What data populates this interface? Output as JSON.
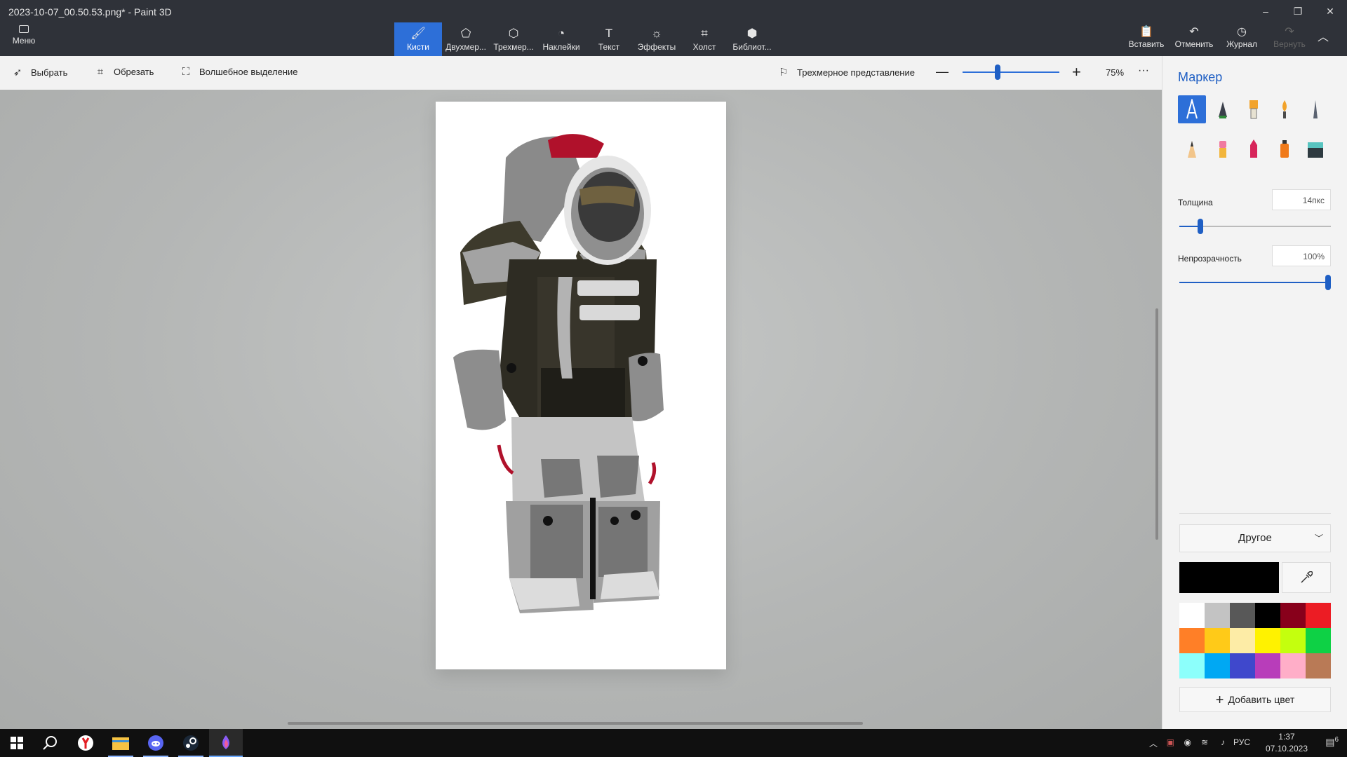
{
  "window": {
    "title": "2023-10-07_00.50.53.png* - Paint 3D",
    "controls": {
      "minimize": "–",
      "restore": "❐",
      "close": "✕"
    }
  },
  "ribbon": {
    "menu_label": "Меню",
    "tabs": [
      {
        "label": "Кисти",
        "icon": "brush-icon",
        "glyph": "🖌"
      },
      {
        "label": "Двухмер...",
        "icon": "shapes-2d-icon",
        "glyph": "⬠"
      },
      {
        "label": "Трехмер...",
        "icon": "cube-icon",
        "glyph": "⬡"
      },
      {
        "label": "Наклейки",
        "icon": "sticker-icon",
        "glyph": "◔"
      },
      {
        "label": "Текст",
        "icon": "text-icon",
        "glyph": "T"
      },
      {
        "label": "Эффекты",
        "icon": "effects-icon",
        "glyph": "☼"
      },
      {
        "label": "Холст",
        "icon": "canvas-icon",
        "glyph": "⌗"
      },
      {
        "label": "Библиот...",
        "icon": "library-icon",
        "glyph": "⬢"
      }
    ],
    "right": {
      "paste": "Вставить",
      "undo": "Отменить",
      "history": "Журнал",
      "redo": "Вернуть"
    }
  },
  "toolbar": {
    "select": "Выбрать",
    "crop": "Обрезать",
    "magic_select": "Волшебное выделение",
    "view_3d": "Трехмерное представление",
    "zoom_minus": "—",
    "zoom_plus": "+",
    "zoom_percent": "75%",
    "more": "···",
    "zoom_level": 0.38
  },
  "panel": {
    "title": "Маркер",
    "brushes": [
      "marker-icon",
      "calligraphy-pen-icon",
      "oil-brush-icon",
      "watercolor-icon",
      "pixel-pen-icon",
      "pencil-icon",
      "eraser-icon",
      "crayon-icon",
      "spray-can-icon",
      "fill-bucket-icon"
    ],
    "thickness_label": "Толщина",
    "thickness_value": "14пкс",
    "thickness_level": 0.14,
    "opacity_label": "Непрозрачность",
    "opacity_value": "100%",
    "opacity_level": 1.0,
    "other_label": "Другое",
    "current_color": "#000000",
    "palette": [
      "#ffffff",
      "#c3c3c3",
      "#585858",
      "#000000",
      "#88001b",
      "#ec1c24",
      "#ff7f27",
      "#ffca18",
      "#fdeca6",
      "#fff200",
      "#c4ff0e",
      "#0ed145",
      "#8cfffb",
      "#00a8f3",
      "#3f48cc",
      "#b83dba",
      "#ffaec8",
      "#b97a56"
    ],
    "add_color_label": "Добавить цвет"
  },
  "taskbar": {
    "apps": [
      "windows-start-icon",
      "search-icon",
      "yandex-browser-icon",
      "file-explorer-icon",
      "discord-icon",
      "steam-icon",
      "paint3d-icon"
    ],
    "lang": "РУС",
    "time": "1:37",
    "date": "07.10.2023",
    "notifications": "6"
  }
}
